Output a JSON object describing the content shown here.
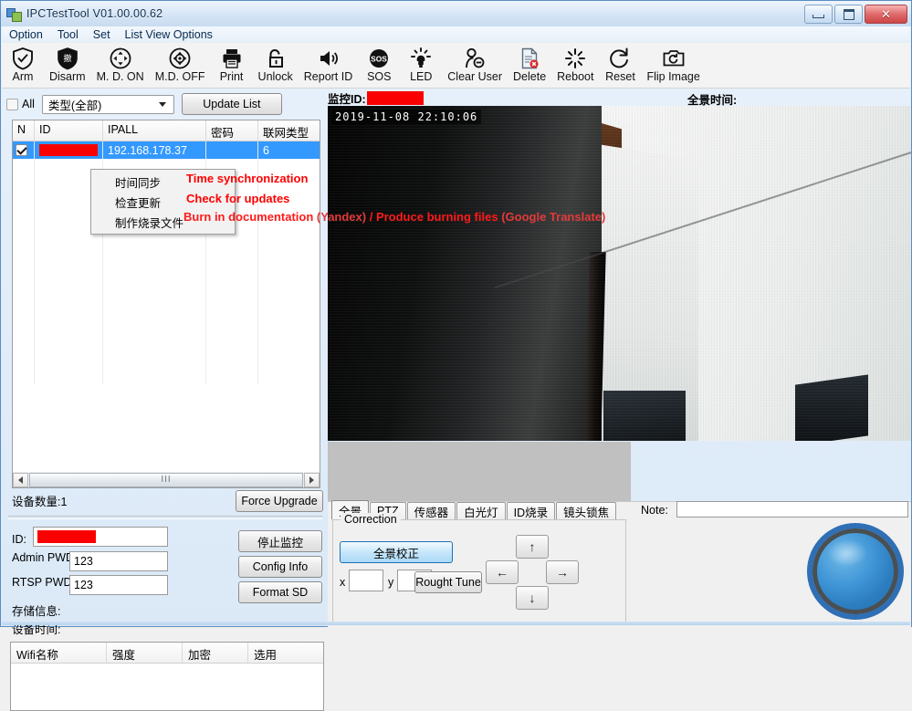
{
  "window": {
    "title": "IPCTestTool V01.00.00.62",
    "minimize": "minimize",
    "maximize": "maximize",
    "close": "close"
  },
  "menubar": {
    "items": [
      "Option",
      "Tool",
      "Set",
      "List View Options"
    ]
  },
  "toolbar": {
    "buttons": [
      {
        "label": "Arm",
        "icon": "shield-check-icon"
      },
      {
        "label": "Disarm",
        "icon": "shield-chinese-icon"
      },
      {
        "label": "M. D. ON",
        "icon": "motion-detect-on-icon"
      },
      {
        "label": "M.D. OFF",
        "icon": "motion-detect-off-icon"
      },
      {
        "label": "Print",
        "icon": "printer-icon"
      },
      {
        "label": "Unlock",
        "icon": "unlock-icon"
      },
      {
        "label": "Report ID",
        "icon": "speaker-icon"
      },
      {
        "label": "SOS",
        "icon": "sos-icon"
      },
      {
        "label": "LED",
        "icon": "led-icon"
      },
      {
        "label": "Clear User",
        "icon": "user-minus-icon"
      },
      {
        "label": "Delete",
        "label2": "",
        "icon": "document-delete-icon"
      },
      {
        "label": "Reboot",
        "icon": "reboot-icon"
      },
      {
        "label": "Reset",
        "icon": "reset-icon"
      },
      {
        "label": "Flip Image",
        "icon": "camera-flip-icon"
      }
    ]
  },
  "filter": {
    "all_checkbox_label": "All",
    "all_checked": false,
    "type_select_value": "类型(全部)",
    "update_list_label": "Update List"
  },
  "device_list": {
    "columns": [
      "N",
      "ID",
      "IPALL",
      "密码",
      "联网类型"
    ],
    "rows": [
      {
        "checked": true,
        "id": "",
        "id_redacted": true,
        "ip": "192.168.178.37",
        "password": "",
        "net_type": "6",
        "selected": true
      }
    ],
    "empty_row_count": 13
  },
  "context_menu": {
    "items": [
      {
        "cn": "时间同步",
        "en": "Time synchronization"
      },
      {
        "cn": "检查更新",
        "en": "Check for updates"
      },
      {
        "cn": "制作烧录文件",
        "en": "Burn in documentation",
        "en_src": "(Yandex)",
        "en_alt": "/ Produce burning files",
        "en_alt_src": "(Google Translate)"
      }
    ]
  },
  "list_footer": {
    "device_count_label": "设备数量:1",
    "force_upgrade_label": "Force Upgrade"
  },
  "scrollbar": {
    "left_arrow": "left-arrow",
    "right_arrow": "right-arrow",
    "thumb_grip": "III"
  },
  "info_form": {
    "id_label": "ID:",
    "id_value": "",
    "id_redacted": true,
    "admin_pwd_label": "Admin PWD",
    "admin_pwd_value": "123",
    "rtsp_pwd_label": "RTSP PWD",
    "rtsp_pwd_value": "123",
    "storage_label": "存储信息:",
    "device_time_label": "设备时间:",
    "buttons": [
      {
        "label": "停止监控",
        "name": "stop-monitor-button"
      },
      {
        "label": "Config Info",
        "name": "config-info-button"
      },
      {
        "label": "Format SD",
        "name": "format-sd-button"
      }
    ]
  },
  "wifi_table": {
    "columns": [
      "Wifi名称",
      "强度",
      "加密",
      "选用"
    ],
    "rows": []
  },
  "video_panel": {
    "monitor_id_label": "监控ID:",
    "monitor_id_value": "",
    "monitor_id_redacted": true,
    "pano_time_label": "全景时间:",
    "pano_time_value": "",
    "timestamp_overlay": "2019-11-08  22:10:06"
  },
  "bottom_tabs": {
    "tabs": [
      "全景",
      "PTZ",
      "传感器",
      "白光灯",
      "ID烧录",
      "镜头锁焦"
    ],
    "active_index": 0
  },
  "correction_panel": {
    "group_title": "Correction",
    "calibrate_button": "全景校正",
    "x_label": "x",
    "x_value": "",
    "y_label": "y",
    "y_value": "",
    "rough_tune_button": "Rought Tune",
    "dpad": {
      "up": "↑",
      "down": "↓",
      "left": "←",
      "right": "→"
    }
  },
  "note_panel": {
    "label": "Note:",
    "value": "",
    "joystick": "joystick-indicator"
  },
  "colors": {
    "accent_blue": "#3399ff",
    "redaction": "#fb0000",
    "annotation_red": "#ff0000",
    "annotation_red_dim": "#e23a3a",
    "titlebar_top": "#eef5fd",
    "close_button": "#cd4545",
    "panel_gray": "#f0f0f0"
  }
}
